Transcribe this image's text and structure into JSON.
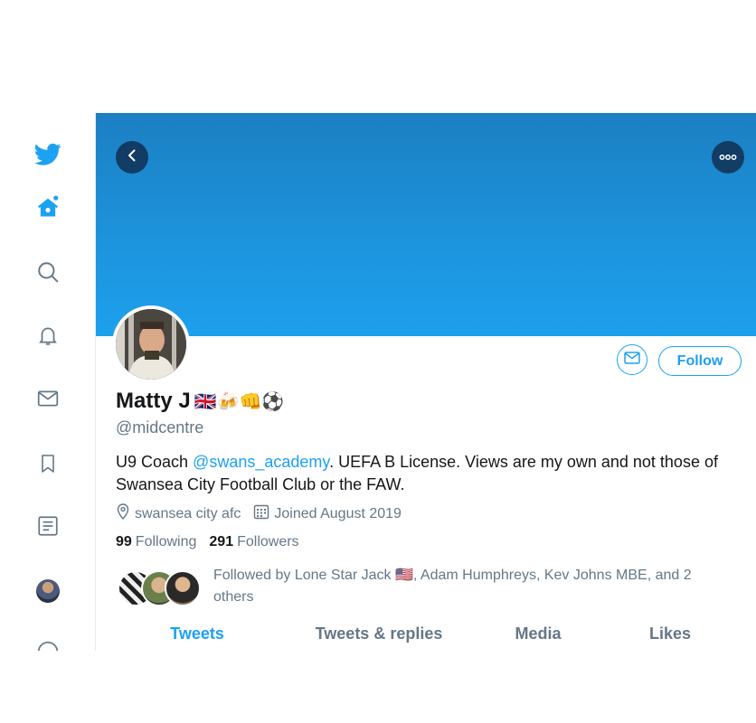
{
  "nav": {
    "items": [
      {
        "icon": "twitter-bird-icon"
      },
      {
        "icon": "home-icon"
      },
      {
        "icon": "search-icon"
      },
      {
        "icon": "notifications-bell-icon"
      },
      {
        "icon": "messages-envelope-icon"
      },
      {
        "icon": "bookmarks-icon"
      },
      {
        "icon": "lists-icon"
      },
      {
        "icon": "account-avatar"
      },
      {
        "icon": "more-icon"
      }
    ]
  },
  "colors": {
    "accent": "#1da1f2",
    "banner": "#1d93dc",
    "secondary_text": "#657786",
    "primary_text": "#14171a"
  },
  "header": {
    "back_icon": "chevron-left-icon",
    "more_icon": "more-dots-icon"
  },
  "profile": {
    "name": "Matty J",
    "name_emojis": "🇬🇧🍻👊⚽",
    "handle": "@midcentre",
    "bio_prefix": "U9 Coach ",
    "bio_mention": "@swans_academy",
    "bio_suffix": ". UEFA B License. Views are my own and not those of Swansea City Football Club or the FAW.",
    "location": "swansea city afc",
    "joined": "Joined August 2019",
    "following_count": "99",
    "following_label": "Following",
    "followers_count": "291",
    "followers_label": "Followers",
    "followed_by": "Followed by Lone Star Jack 🇺🇸, Adam Humphreys, Kev Johns MBE, and 2 others"
  },
  "actions": {
    "follow_label": "Follow",
    "message_icon": "envelope-icon"
  },
  "tabs": [
    {
      "label": "Tweets",
      "active": true
    },
    {
      "label": "Tweets & replies",
      "active": false
    },
    {
      "label": "Media",
      "active": false
    },
    {
      "label": "Likes",
      "active": false
    }
  ]
}
